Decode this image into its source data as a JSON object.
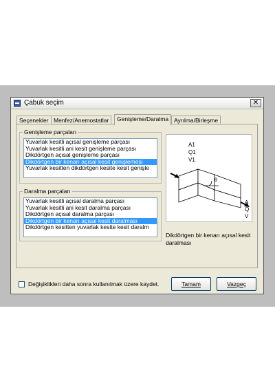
{
  "window": {
    "title": "Çabuk seçim",
    "close_glyph": "✕",
    "app_icon": "app-window-icon"
  },
  "tabs": [
    {
      "label": "Seçenekler"
    },
    {
      "label": "Menfez/Anemostatlar"
    },
    {
      "label": "Genişleme/Daralma"
    },
    {
      "label": "Ayrılma/Birleşme"
    }
  ],
  "active_tab": "Genişleme/Daralma",
  "expansion": {
    "legend": "Genişleme parçaları",
    "items": [
      {
        "label": "Yuvarlak kesitli açısal genişleme parçası"
      },
      {
        "label": "Yuvarlak kesitli ani kesit genişleme parçası"
      },
      {
        "label": "Dikdörtgen açısal genişleme parçası"
      },
      {
        "label": "Dikdörtgen bir kenarı açısal kesit genişlemesi"
      },
      {
        "label": "Yuvarlak kesitten dikdörtgen kesite kesit genişle"
      }
    ],
    "selected_index": 3
  },
  "contraction": {
    "legend": "Daralma parçaları",
    "items": [
      {
        "label": "Yuvarlak kesitli açısal daralma parçası"
      },
      {
        "label": "Yuvarlak kesitli ani kesit daralma parçası"
      },
      {
        "label": "Dikdörtgen açısal daralma parçası"
      },
      {
        "label": "Dikdörtgen bir kenarı açısal kesit daralması"
      },
      {
        "label": "Dikdörtgen kesitten yuvarlak kesite kesit daralm"
      }
    ],
    "selected_index": 3
  },
  "preview": {
    "in_labels": [
      "A1",
      "Q1",
      "V1"
    ],
    "out_labels": [
      "A",
      "Q",
      "V"
    ],
    "angle_label": "θ",
    "caption": "Dikdörtgen bir kenarı açısal kesit daralması"
  },
  "footer": {
    "checkbox_label": "Değişiklikleri daha sonra kullanılmak üzere kaydet.",
    "checked": false,
    "ok_label": "Tamam",
    "cancel_label": "Vazgeç"
  }
}
